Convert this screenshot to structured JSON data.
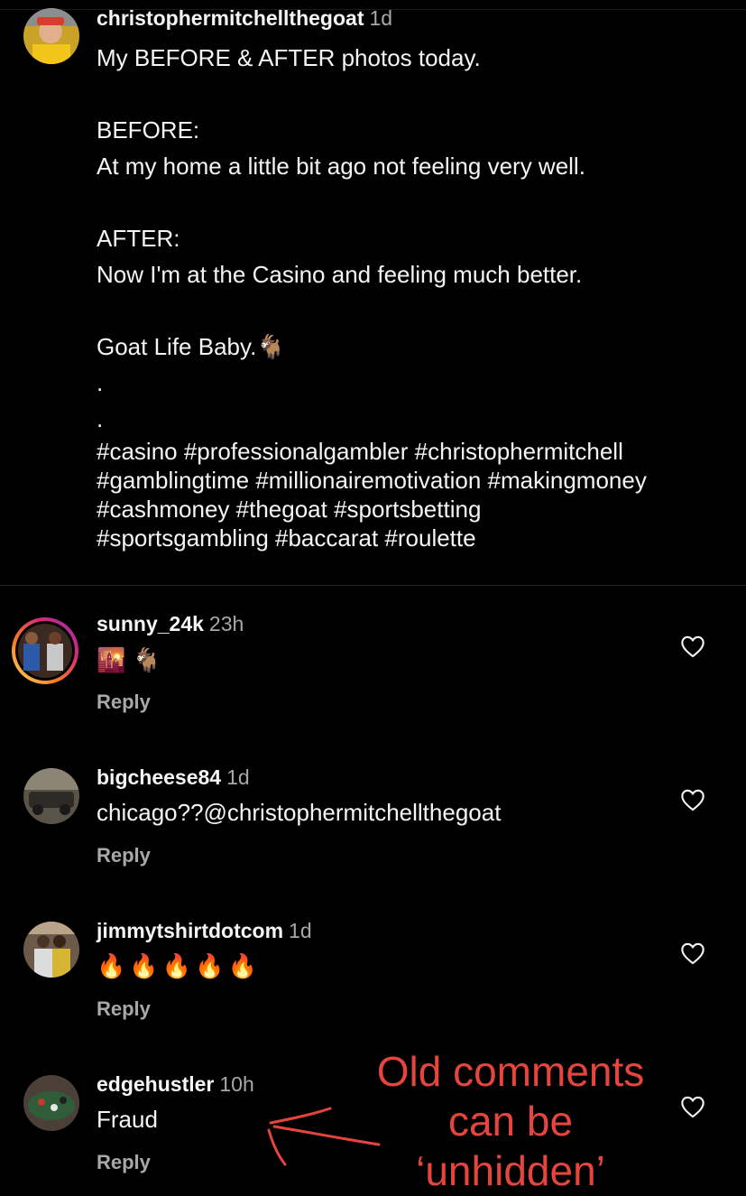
{
  "post": {
    "username": "christophermitchellthegoat",
    "time": "1d",
    "caption_lines": [
      "My BEFORE & AFTER photos today.",
      "",
      "BEFORE:",
      "At my home a little bit ago not feeling very well.",
      "",
      "AFTER:",
      "Now I'm at the Casino and feeling much better.",
      "",
      "Goat Life Baby.🐐",
      ".",
      "."
    ],
    "hashtag_lines": [
      "#casino #professionalgambler #christophermitchell",
      "#gamblingtime #millionairemotivation #makingmoney",
      "#cashmoney #thegoat #sportsbetting",
      "#sportsgambling #baccarat #roulette"
    ]
  },
  "comments": [
    {
      "username": "sunny_24k",
      "time": "23h",
      "text": "🌇 🐐",
      "reply_label": "Reply",
      "heart_icon": "heart-outline-icon"
    },
    {
      "username": "bigcheese84",
      "time": "1d",
      "text": "chicago??@christophermitchellthegoat",
      "reply_label": "Reply",
      "heart_icon": "heart-outline-icon"
    },
    {
      "username": "jimmytshirtdotcom",
      "time": "1d",
      "text": "🔥🔥🔥🔥🔥",
      "reply_label": "Reply",
      "heart_icon": "heart-outline-icon"
    },
    {
      "username": "edgehustler",
      "time": "10h",
      "text": "Fraud",
      "reply_label": "Reply",
      "heart_icon": "heart-outline-icon"
    }
  ],
  "annotation": {
    "lines": [
      "Old comments",
      "can be",
      "‘unhidden’"
    ],
    "color": "#e5453d"
  },
  "colors": {
    "background": "#000000",
    "text": "#f5f5f5",
    "secondary_text": "#a8a8a8",
    "story_ring": [
      "#feda75",
      "#fa7e1e",
      "#d62976",
      "#962fbf"
    ]
  }
}
